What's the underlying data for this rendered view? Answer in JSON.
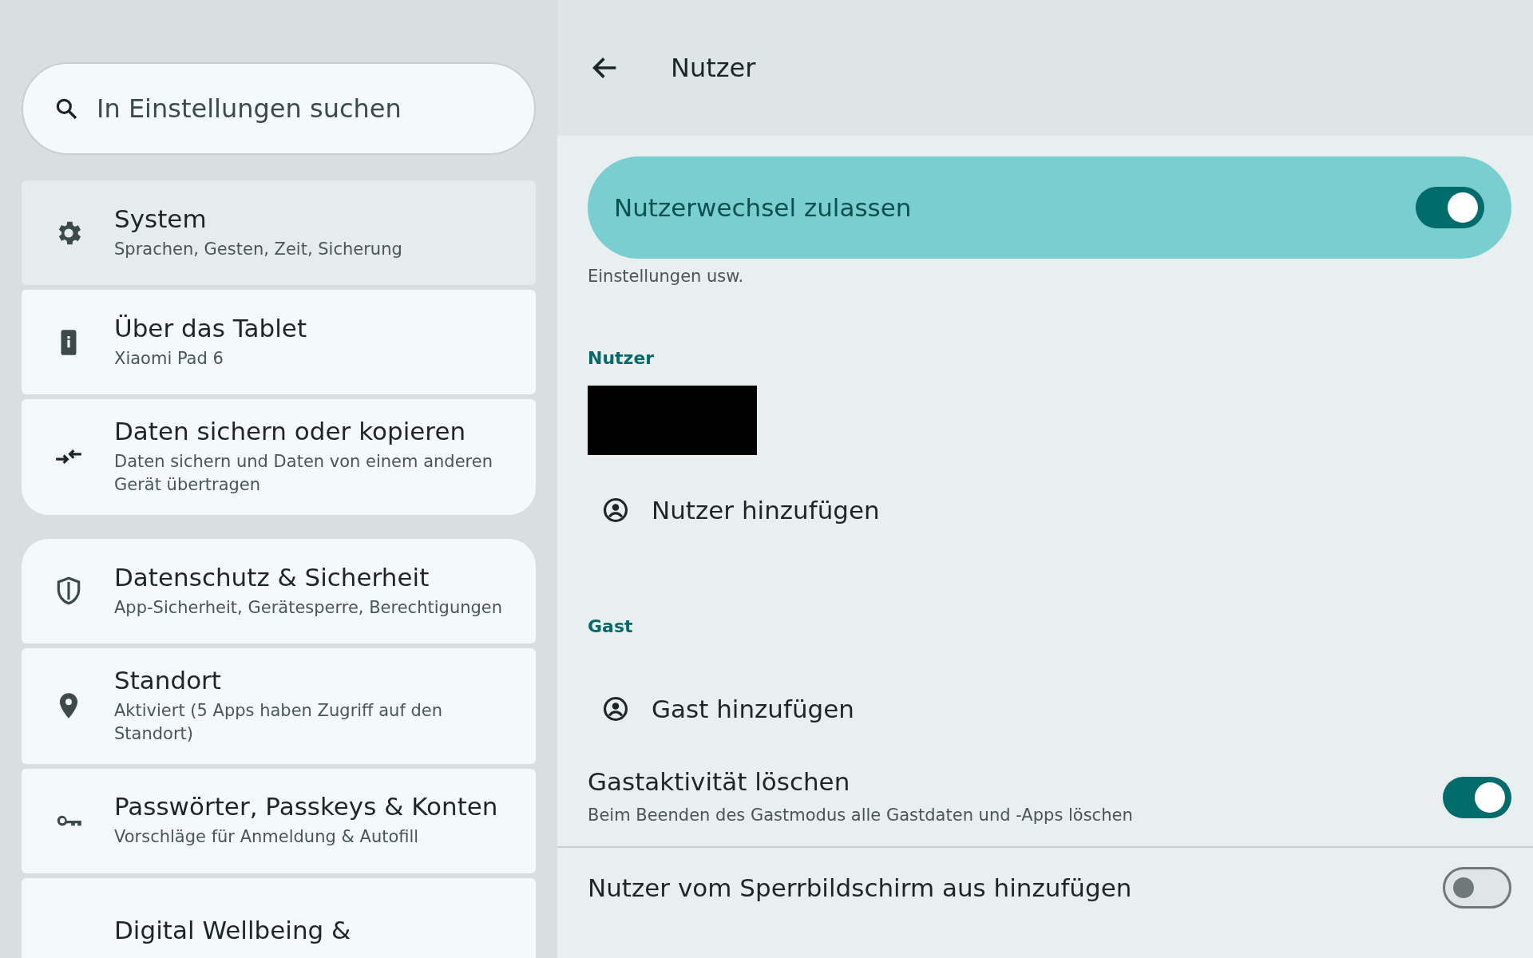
{
  "search": {
    "placeholder": "In Einstellungen suchen"
  },
  "sidebar": {
    "groups": [
      {
        "items": [
          {
            "title": "System",
            "subtitle": "Sprachen, Gesten, Zeit, Sicherung",
            "selected": true
          },
          {
            "title": "Über das Tablet",
            "subtitle": "Xiaomi Pad 6",
            "selected": false
          },
          {
            "title": "Daten sichern oder kopieren",
            "subtitle": "Daten sichern und Daten von einem anderen Gerät übertragen",
            "selected": false
          }
        ]
      },
      {
        "items": [
          {
            "title": "Datenschutz & Sicherheit",
            "subtitle": "App-Sicherheit, Gerätesperre, Berechtigungen",
            "selected": false
          },
          {
            "title": "Standort",
            "subtitle": "Aktiviert (5 Apps haben Zugriff auf den Standort)",
            "selected": false
          },
          {
            "title": "Passwörter, Passkeys & Konten",
            "subtitle": "Vorschläge für Anmeldung & Autofill",
            "selected": false
          },
          {
            "title": "Digital Wellbeing &",
            "selected": false
          }
        ]
      }
    ]
  },
  "header": {
    "title": "Nutzer"
  },
  "main_switch": {
    "label": "Nutzerwechsel zulassen",
    "on": true
  },
  "description": "Einstellungen usw.",
  "sections": [
    {
      "title": "Nutzer",
      "items": [
        {
          "kind": "redacted"
        },
        {
          "kind": "action",
          "label": "Nutzer hinzufügen"
        }
      ]
    },
    {
      "title": "Gast",
      "items": [
        {
          "kind": "action",
          "label": "Gast hinzufügen"
        },
        {
          "kind": "switch",
          "label": "Gastaktivität löschen",
          "subtitle": "Beim Beenden des Gastmodus alle Gastdaten und -Apps löschen",
          "on": true
        }
      ]
    }
  ],
  "lock_screen": {
    "label": "Nutzer vom Sperrbildschirm aus hinzufügen",
    "on": false
  }
}
